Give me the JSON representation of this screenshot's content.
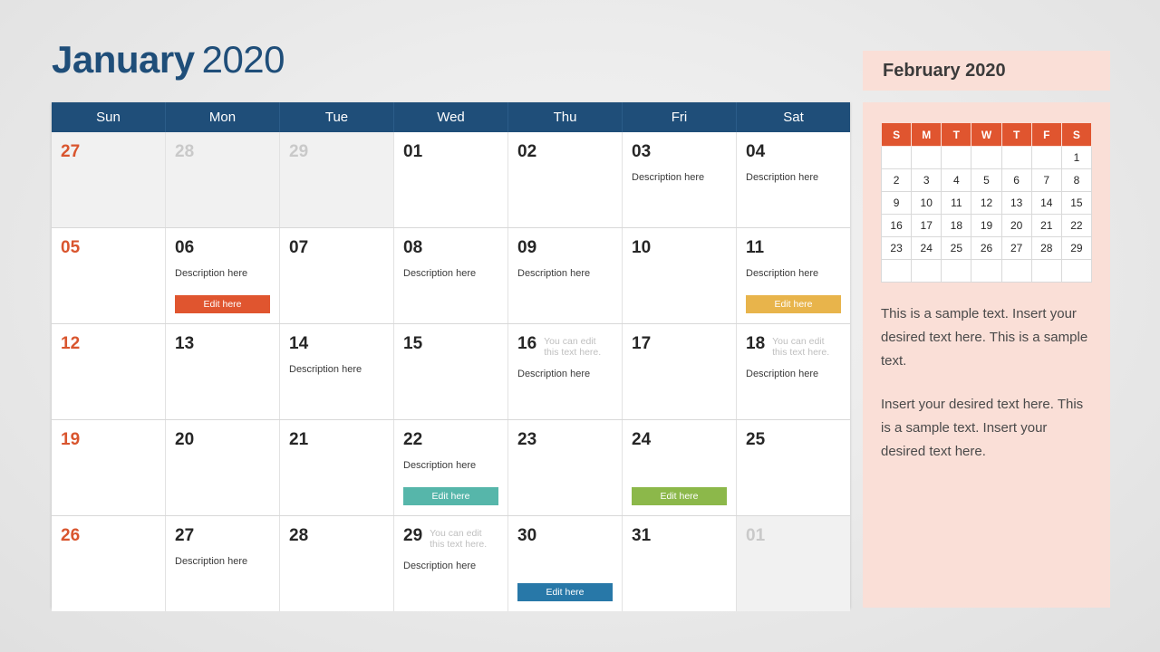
{
  "title": {
    "month": "January",
    "year": "2020"
  },
  "calendar": {
    "weekdays": [
      "Sun",
      "Mon",
      "Tue",
      "Wed",
      "Thu",
      "Fri",
      "Sat"
    ],
    "header_color": "#1F4E79",
    "sunday_color": "#D9552E",
    "weeks": [
      [
        {
          "day": "27",
          "muted": true,
          "sunday": true,
          "note": "",
          "desc": "",
          "button": null
        },
        {
          "day": "28",
          "muted": true,
          "sunday": false,
          "note": "",
          "desc": "",
          "button": null
        },
        {
          "day": "29",
          "muted": true,
          "sunday": false,
          "note": "",
          "desc": "",
          "button": null
        },
        {
          "day": "01",
          "muted": false,
          "sunday": false,
          "note": "",
          "desc": "",
          "button": null
        },
        {
          "day": "02",
          "muted": false,
          "sunday": false,
          "note": "",
          "desc": "",
          "button": null
        },
        {
          "day": "03",
          "muted": false,
          "sunday": false,
          "note": "",
          "desc": "Description here",
          "button": null
        },
        {
          "day": "04",
          "muted": false,
          "sunday": false,
          "note": "",
          "desc": "Description here",
          "button": null
        }
      ],
      [
        {
          "day": "05",
          "muted": false,
          "sunday": true,
          "note": "",
          "desc": "",
          "button": null
        },
        {
          "day": "06",
          "muted": false,
          "sunday": false,
          "note": "",
          "desc": "Description here",
          "button": {
            "label": "Edit here",
            "color": "#E0552F"
          }
        },
        {
          "day": "07",
          "muted": false,
          "sunday": false,
          "note": "",
          "desc": "",
          "button": null
        },
        {
          "day": "08",
          "muted": false,
          "sunday": false,
          "note": "",
          "desc": "Description here",
          "button": null
        },
        {
          "day": "09",
          "muted": false,
          "sunday": false,
          "note": "",
          "desc": "Description here",
          "button": null
        },
        {
          "day": "10",
          "muted": false,
          "sunday": false,
          "note": "",
          "desc": "",
          "button": null
        },
        {
          "day": "11",
          "muted": false,
          "sunday": false,
          "note": "",
          "desc": "Description here",
          "button": {
            "label": "Edit here",
            "color": "#E8B44B"
          }
        }
      ],
      [
        {
          "day": "12",
          "muted": false,
          "sunday": true,
          "note": "",
          "desc": "",
          "button": null
        },
        {
          "day": "13",
          "muted": false,
          "sunday": false,
          "note": "",
          "desc": "",
          "button": null
        },
        {
          "day": "14",
          "muted": false,
          "sunday": false,
          "note": "",
          "desc": "Description here",
          "button": null
        },
        {
          "day": "15",
          "muted": false,
          "sunday": false,
          "note": "",
          "desc": "",
          "button": null
        },
        {
          "day": "16",
          "muted": false,
          "sunday": false,
          "note": "You can edit this text here.",
          "desc": "Description here",
          "button": null
        },
        {
          "day": "17",
          "muted": false,
          "sunday": false,
          "note": "",
          "desc": "",
          "button": null
        },
        {
          "day": "18",
          "muted": false,
          "sunday": false,
          "note": "You can edit this text here.",
          "desc": "Description here",
          "button": null
        }
      ],
      [
        {
          "day": "19",
          "muted": false,
          "sunday": true,
          "note": "",
          "desc": "",
          "button": null
        },
        {
          "day": "20",
          "muted": false,
          "sunday": false,
          "note": "",
          "desc": "",
          "button": null
        },
        {
          "day": "21",
          "muted": false,
          "sunday": false,
          "note": "",
          "desc": "",
          "button": null
        },
        {
          "day": "22",
          "muted": false,
          "sunday": false,
          "note": "",
          "desc": "Description here",
          "button": {
            "label": "Edit here",
            "color": "#56B6AA"
          }
        },
        {
          "day": "23",
          "muted": false,
          "sunday": false,
          "note": "",
          "desc": "",
          "button": null
        },
        {
          "day": "24",
          "muted": false,
          "sunday": false,
          "note": "",
          "desc": "",
          "button": {
            "label": "Edit here",
            "color": "#8CB84A"
          }
        },
        {
          "day": "25",
          "muted": false,
          "sunday": false,
          "note": "",
          "desc": "",
          "button": null
        }
      ],
      [
        {
          "day": "26",
          "muted": false,
          "sunday": true,
          "note": "",
          "desc": "",
          "button": null
        },
        {
          "day": "27",
          "muted": false,
          "sunday": false,
          "note": "",
          "desc": "Description here",
          "button": null
        },
        {
          "day": "28",
          "muted": false,
          "sunday": false,
          "note": "",
          "desc": "",
          "button": null
        },
        {
          "day": "29",
          "muted": false,
          "sunday": false,
          "note": "You can edit this text here.",
          "desc": "Description here",
          "button": null
        },
        {
          "day": "30",
          "muted": false,
          "sunday": false,
          "note": "",
          "desc": "",
          "button": {
            "label": "Edit here",
            "color": "#2878A8"
          }
        },
        {
          "day": "31",
          "muted": false,
          "sunday": false,
          "note": "",
          "desc": "",
          "button": null
        },
        {
          "day": "01",
          "muted": true,
          "sunday": false,
          "note": "",
          "desc": "",
          "button": null
        }
      ]
    ]
  },
  "sidebar": {
    "title": "February 2020",
    "panel_color": "#FADFD7",
    "mini_calendar": {
      "weekdays": [
        "S",
        "M",
        "T",
        "W",
        "T",
        "F",
        "S"
      ],
      "header_color": "#E0552F",
      "weeks": [
        [
          "",
          "",
          "",
          "",
          "",
          "",
          "1"
        ],
        [
          "2",
          "3",
          "4",
          "5",
          "6",
          "7",
          "8"
        ],
        [
          "9",
          "10",
          "11",
          "12",
          "13",
          "14",
          "15"
        ],
        [
          "16",
          "17",
          "18",
          "19",
          "20",
          "21",
          "22"
        ],
        [
          "23",
          "24",
          "25",
          "26",
          "27",
          "28",
          "29"
        ],
        [
          "",
          "",
          "",
          "",
          "",
          "",
          ""
        ]
      ]
    },
    "paragraphs": [
      "This is a sample text. Insert your desired text here. This is a sample text.",
      "Insert your desired text here. This is a sample text. Insert your desired text here."
    ]
  }
}
